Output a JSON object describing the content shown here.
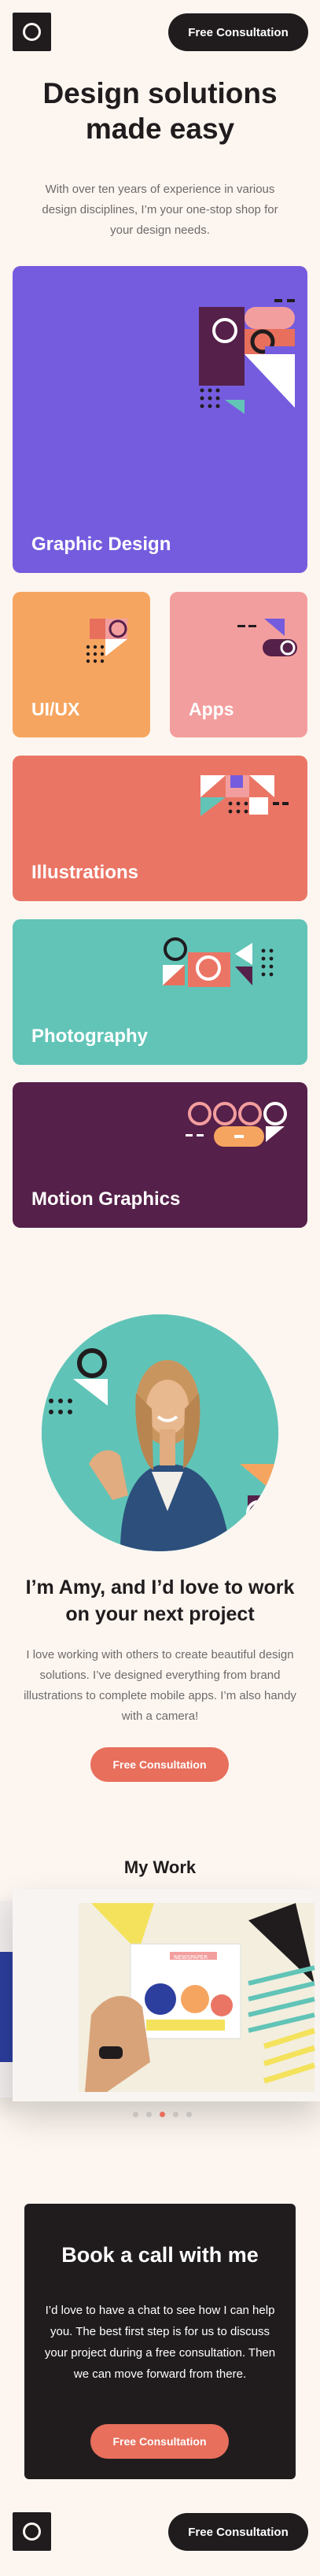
{
  "header": {
    "consultation_label": "Free Consultation",
    "logo_icon": "circle-logo-icon"
  },
  "hero": {
    "title": "Design solutions made easy",
    "text": "With over ten years of experience in various design disciplines, I’m your one-stop shop for your design needs."
  },
  "services": [
    {
      "label": "Graphic Design",
      "color": "#755cde"
    },
    {
      "label": "UI/UX",
      "color": "#f6a560"
    },
    {
      "label": "Apps",
      "color": "#f39e9e"
    },
    {
      "label": "Illustrations",
      "color": "#eb7565"
    },
    {
      "label": "Photography",
      "color": "#61c4b7"
    },
    {
      "label": "Motion Graphics",
      "color": "#552049"
    }
  ],
  "about": {
    "title": "I’m Amy, and I’d love to work on your next project",
    "text": "I love working with others to create beautiful design solutions. I’ve designed everything from brand illustrations to complete mobile apps. I’m also handy with a camera!",
    "button_label": "Free Consultation"
  },
  "work": {
    "title": "My Work",
    "active_slide": 3,
    "slide_count": 5,
    "newspaper_text": "NEWSPAPER"
  },
  "cta": {
    "title": "Book a call with me",
    "text": "I’d love to have a chat to see how I can help you. The best first step is for us to discuss your project during a free consultation. Then we can move forward from there.",
    "button_label": "Free Consultation"
  },
  "footer": {
    "consultation_label": "Free Consultation",
    "logo_icon": "circle-logo-icon"
  },
  "colors": {
    "background": "#fdf6f0",
    "dark": "#201c1e",
    "coral": "#e76f5c",
    "gray_text": "#6d6a6b"
  }
}
